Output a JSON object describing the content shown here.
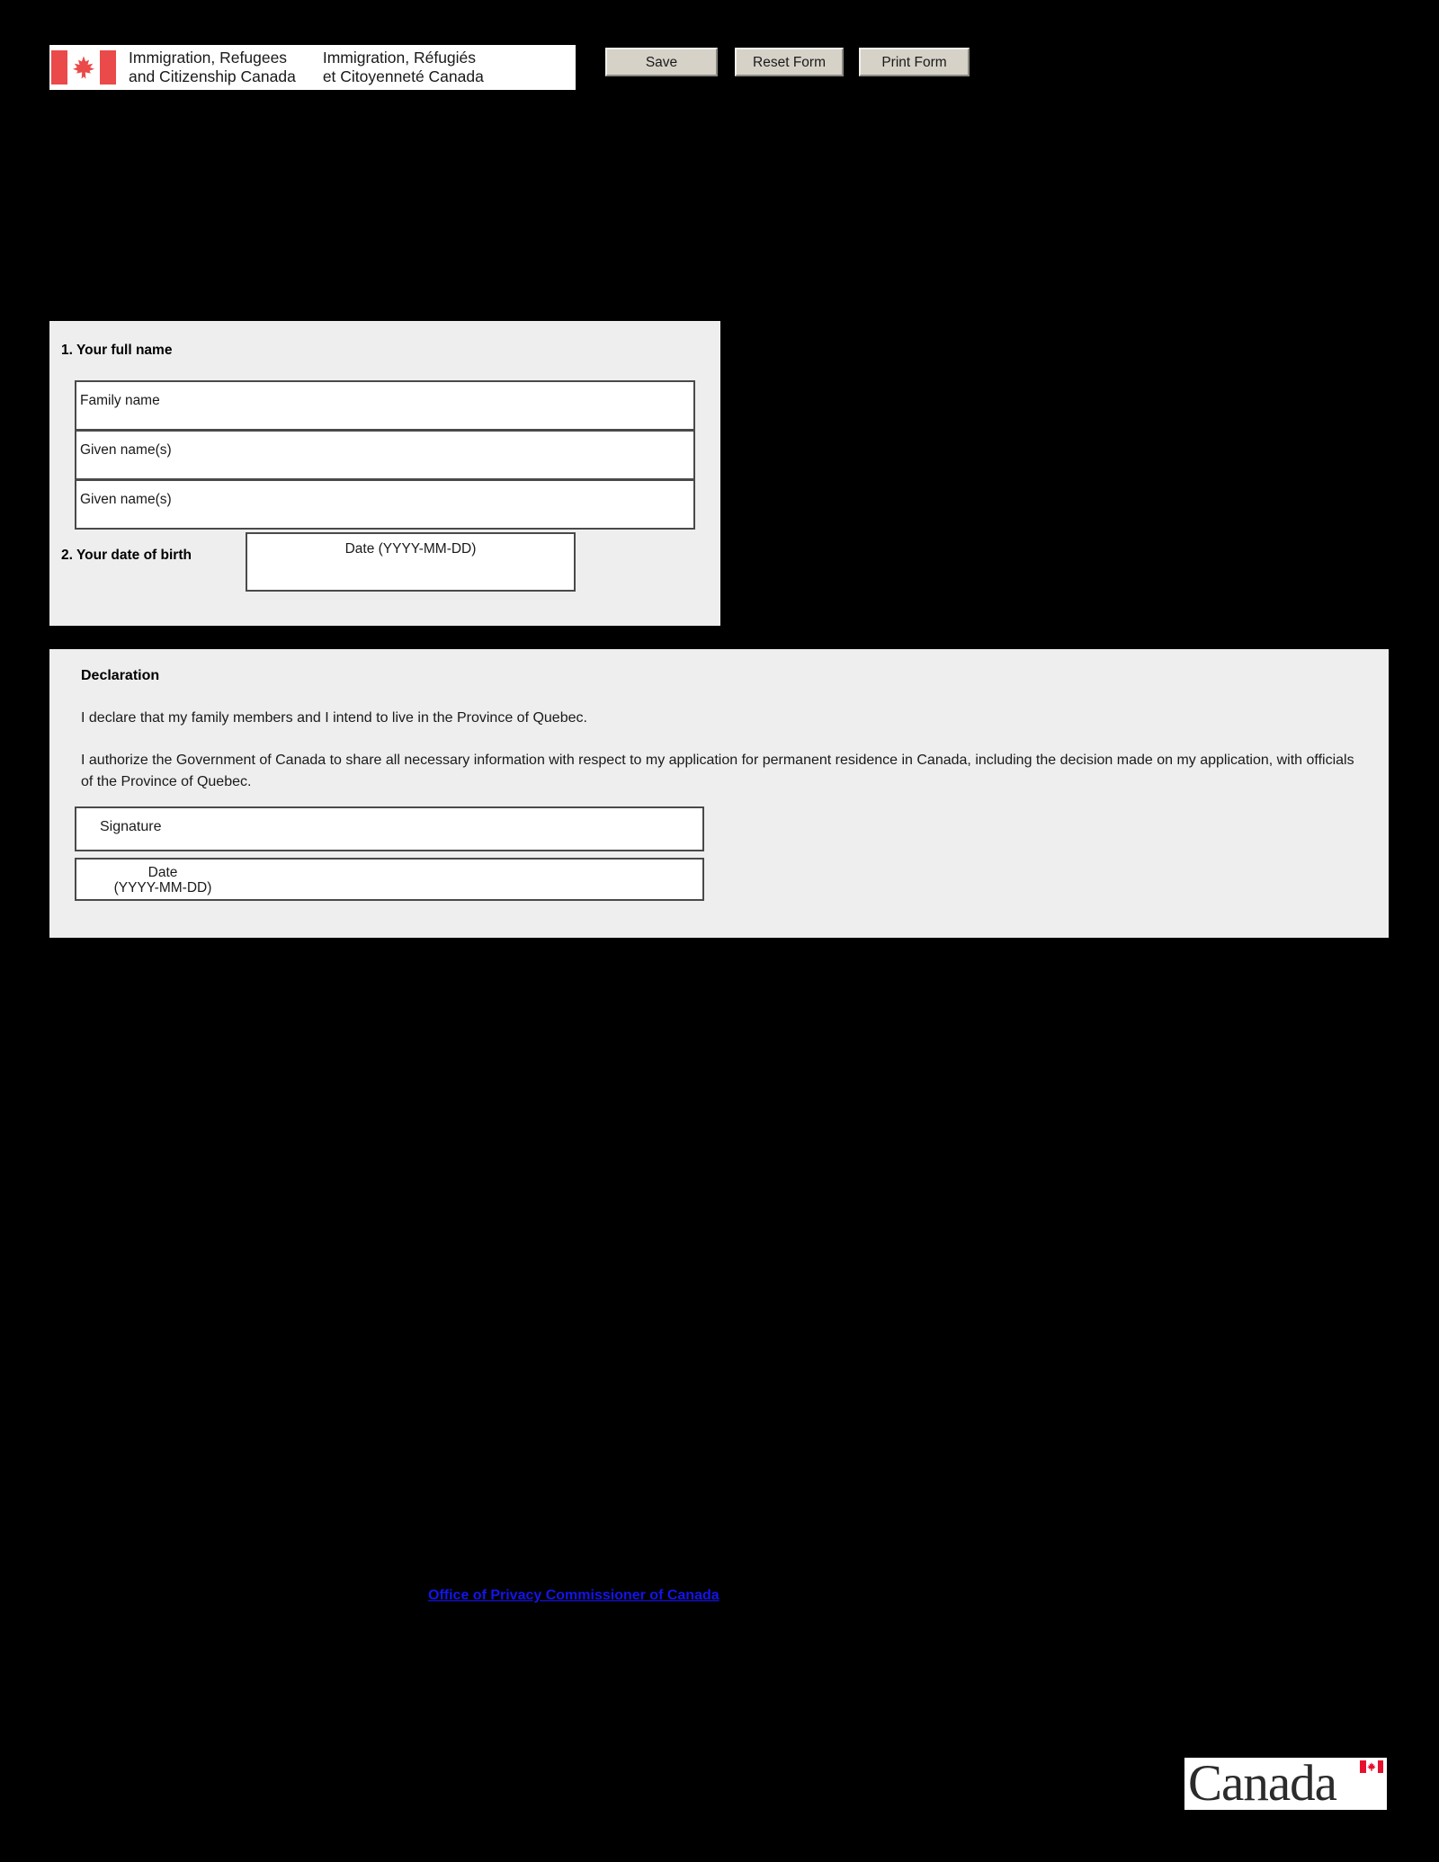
{
  "header": {
    "logo": {
      "flag_icon": "canada-flag-icon",
      "english_line_1": "Immigration, Refugees",
      "english_line_2": "and Citizenship Canada",
      "french_line_1": "Immigration, Réfugiés",
      "french_line_2": "et Citoyenneté Canada"
    },
    "buttons": {
      "save": "Save",
      "reset": "Reset Form",
      "print": "Print Form"
    }
  },
  "personal_section": {
    "question_1_label": "1. Your full name",
    "fields": {
      "family_name": "Family name",
      "given_name_1": "Given name(s)",
      "given_name_2": "Given name(s)"
    },
    "question_2_label": "2. Your date of birth",
    "date_of_birth_caption": "Date (YYYY-MM-DD)"
  },
  "declaration_section": {
    "title": "Declaration",
    "paragraph_1": "I declare that my family members and I intend to live in the Province of Quebec.",
    "paragraph_2": "I authorize the Government of Canada to share all necessary information with respect to my application for permanent residence in Canada, including the decision made on my application, with officials of the Province of Quebec.",
    "signature_caption": "Signature",
    "date_caption": "Date\n(YYYY-MM-DD)",
    "date_caption_line_1": "Date",
    "date_caption_line_2": "(YYYY-MM-DD)"
  },
  "footer": {
    "privacy_link": "Office of Privacy Commissioner of Canada",
    "canada_wordmark": "Canada"
  },
  "colors": {
    "page_background": "#000000",
    "panel_background": "#eeeeee",
    "field_background": "#ffffff",
    "field_border": "#4a4a4a",
    "button_face": "#d6d2c8",
    "link": "#1414ee",
    "flag_red": "#ea4a4a",
    "wordmark_red": "#e8112d"
  }
}
